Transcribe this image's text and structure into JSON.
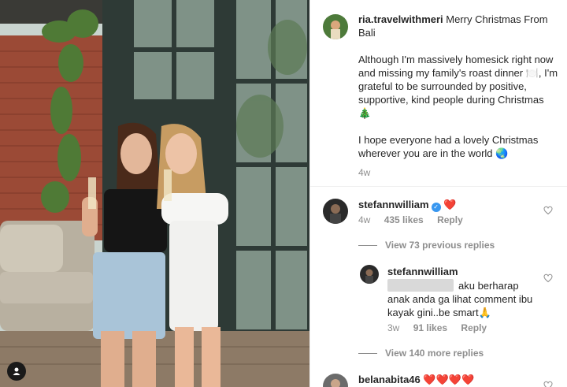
{
  "post": {
    "photo_alt": "two women holding champagne glasses",
    "user_tag_icon": "user-icon"
  },
  "caption": {
    "username": "ria.travelwithmeri",
    "line1": "Merry Christmas From Bali",
    "para1": "Although I'm massively homesick right now and missing my family's roast dinner 🍽️, I'm grateful to be surrounded by positive, supportive, kind people during Christmas 🎄",
    "para2": "I hope everyone had a lovely Christmas wherever you are in the world 🌏",
    "time": "4w"
  },
  "comments": [
    {
      "username": "stefannwilliam",
      "text": "❤️",
      "time": "4w",
      "likes": "435 likes",
      "reply_label": "Reply",
      "view_replies": "View 73 previous replies"
    },
    {
      "username": "stefannwilliam",
      "text": "aku berharap anak anda ga lihat comment ibu kayak gini..be smart🙏",
      "time": "3w",
      "likes": "91 likes",
      "reply_label": "Reply",
      "view_replies": "View 140 more replies"
    },
    {
      "username": "belanabita46",
      "text": "❤️❤️❤️❤️"
    }
  ],
  "colors": {
    "text": "#262626",
    "secondary": "#8e8e8e",
    "verified": "#3897f0",
    "heart": "#d10f2a"
  }
}
